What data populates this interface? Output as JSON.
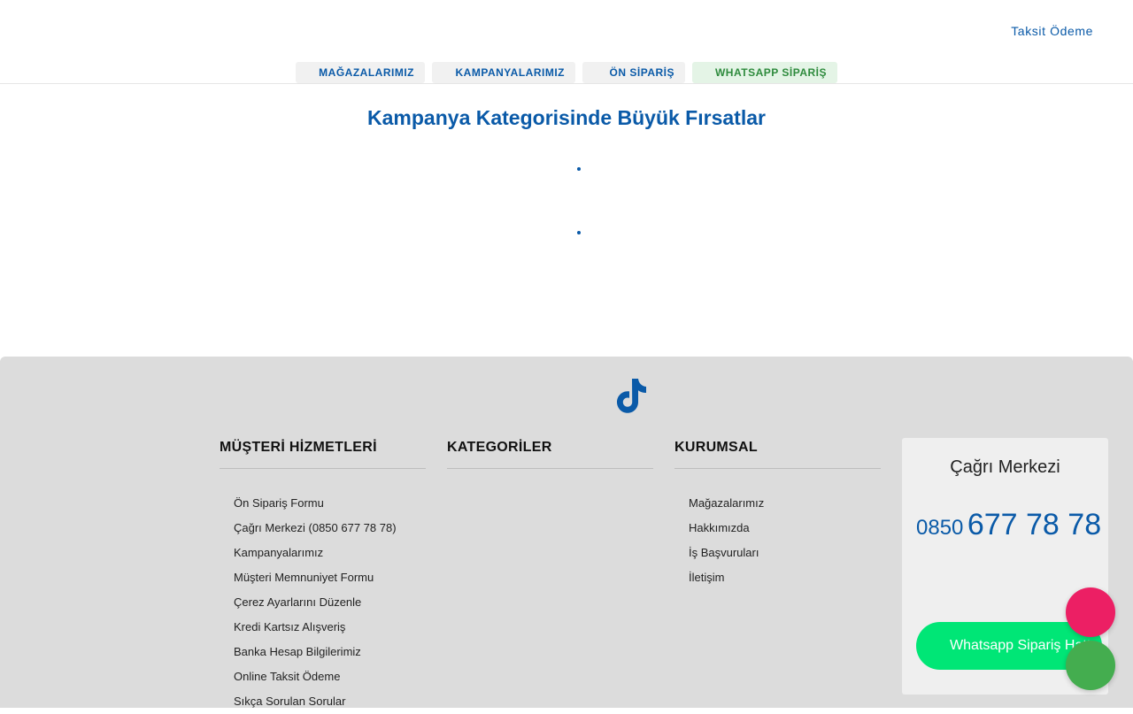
{
  "header": {
    "taksit_link": "Taksit Ödeme",
    "nav": [
      {
        "label": "MAĞAZALARIMIZ"
      },
      {
        "label": "KAMPANYALARIMIZ"
      },
      {
        "label": "ÖN SİPARİŞ"
      },
      {
        "label": "WHATSAPP SİPARİŞ"
      }
    ]
  },
  "main": {
    "headline": "Kampanya Kategorisinde Büyük Fırsatlar"
  },
  "footer": {
    "social_icon": "tiktok-icon",
    "columns": [
      {
        "title": "MÜŞTERİ HİZMETLERİ",
        "links": [
          "Ön Sipariş Formu",
          "Çağrı Merkezi (0850 677 78 78)",
          "Kampanyalarımız",
          "Müşteri Memnuniyet Formu",
          "Çerez Ayarlarını Düzenle",
          "Kredi Kartsız Alışveriş",
          "Banka Hesap Bilgilerimiz",
          "Online Taksit Ödeme",
          "Sıkça Sorulan Sorular"
        ]
      },
      {
        "title": "KATEGORİLER",
        "links": []
      },
      {
        "title": "KURUMSAL",
        "links": [
          "Mağazalarımız",
          "Hakkımızda",
          "İş Başvuruları",
          "İletişim"
        ]
      }
    ],
    "callcenter": {
      "title": "Çağrı Merkezi",
      "number_prefix": "0850",
      "number_main": "677 78 78",
      "whatsapp_button": "Whatsapp Sipariş Hattı"
    }
  },
  "colors": {
    "brand_blue": "#0a5aa8",
    "whatsapp_green": "#00e676",
    "fab_pink": "#ec1f64",
    "fab_green": "#44ad4f",
    "footer_bg": "#dcdcdc"
  }
}
